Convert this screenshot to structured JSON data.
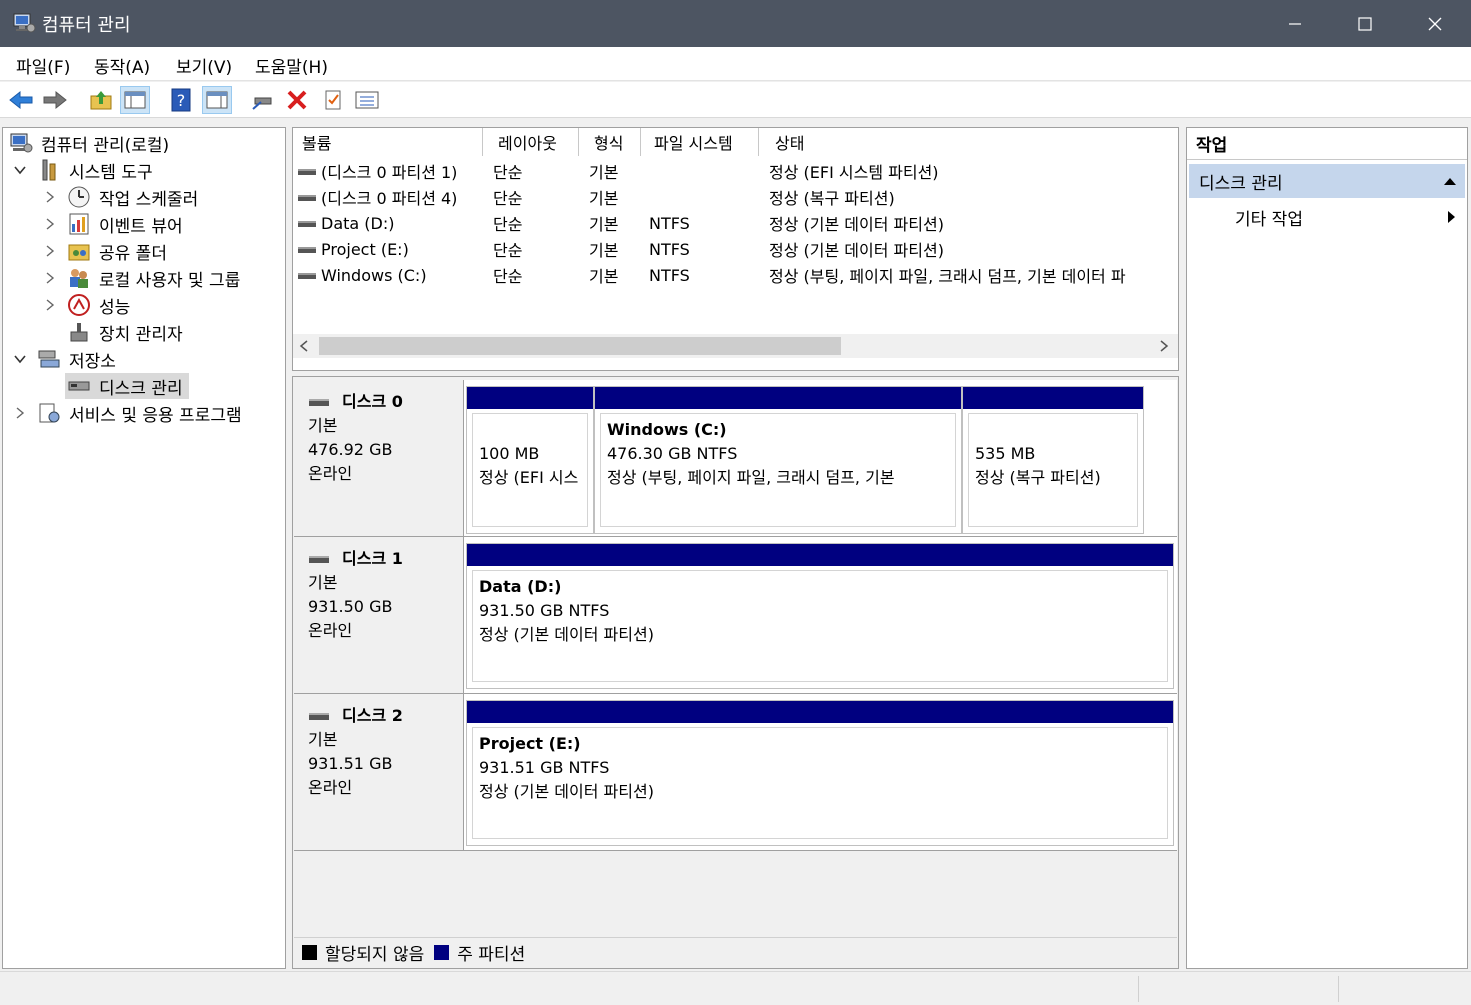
{
  "window": {
    "title": "컴퓨터 관리"
  },
  "menu": [
    "파일(F)",
    "동작(A)",
    "보기(V)",
    "도움말(H)"
  ],
  "tree": {
    "root": "컴퓨터 관리(로컬)",
    "system_tools": "시스템 도구",
    "task_scheduler": "작업 스케줄러",
    "event_viewer": "이벤트 뷰어",
    "shared_folders": "공유 폴더",
    "local_users": "로컬 사용자 및 그룹",
    "performance": "성능",
    "device_manager": "장치 관리자",
    "storage": "저장소",
    "disk_management": "디스크 관리",
    "services": "서비스 및 응용 프로그램"
  },
  "volumes": {
    "headers": [
      "볼륨",
      "레이아웃",
      "형식",
      "파일 시스템",
      "상태"
    ],
    "rows": [
      [
        "(디스크 0 파티션 1)",
        "단순",
        "기본",
        "",
        "정상 (EFI 시스템 파티션)"
      ],
      [
        "(디스크 0 파티션 4)",
        "단순",
        "기본",
        "",
        "정상 (복구 파티션)"
      ],
      [
        "Data (D:)",
        "단순",
        "기본",
        "NTFS",
        "정상 (기본 데이터 파티션)"
      ],
      [
        "Project (E:)",
        "단순",
        "기본",
        "NTFS",
        "정상 (기본 데이터 파티션)"
      ],
      [
        "Windows (C:)",
        "단순",
        "기본",
        "NTFS",
        "정상 (부팅, 페이지 파일, 크래시 덤프, 기본 데이터 파"
      ]
    ]
  },
  "disks": [
    {
      "name": "디스크 0",
      "type": "기본",
      "size": "476.92 GB",
      "status": "온라인",
      "partitions": [
        {
          "title": "",
          "size": "100 MB",
          "status": "정상 (EFI 시스"
        },
        {
          "title": "Windows  (C:)",
          "size": "476.30 GB NTFS",
          "status": "정상 (부팅, 페이지 파일, 크래시 덤프, 기본"
        },
        {
          "title": "",
          "size": "535 MB",
          "status": "정상 (복구 파티션)"
        }
      ]
    },
    {
      "name": "디스크 1",
      "type": "기본",
      "size": "931.50 GB",
      "status": "온라인",
      "partitions": [
        {
          "title": "Data  (D:)",
          "size": "931.50 GB NTFS",
          "status": "정상 (기본 데이터 파티션)"
        }
      ]
    },
    {
      "name": "디스크 2",
      "type": "기본",
      "size": "931.51 GB",
      "status": "온라인",
      "partitions": [
        {
          "title": "Project  (E:)",
          "size": "931.51 GB NTFS",
          "status": "정상 (기본 데이터 파티션)"
        }
      ]
    }
  ],
  "legend": {
    "unallocated": "할당되지 않음",
    "primary": "주 파티션"
  },
  "actions": {
    "header": "작업",
    "section": "디스크 관리",
    "more": "기타 작업"
  },
  "colors": {
    "titlebar": "#4d5562",
    "primary_partition": "#000080",
    "unallocated": "#000000",
    "selection": "#cce4f7"
  }
}
